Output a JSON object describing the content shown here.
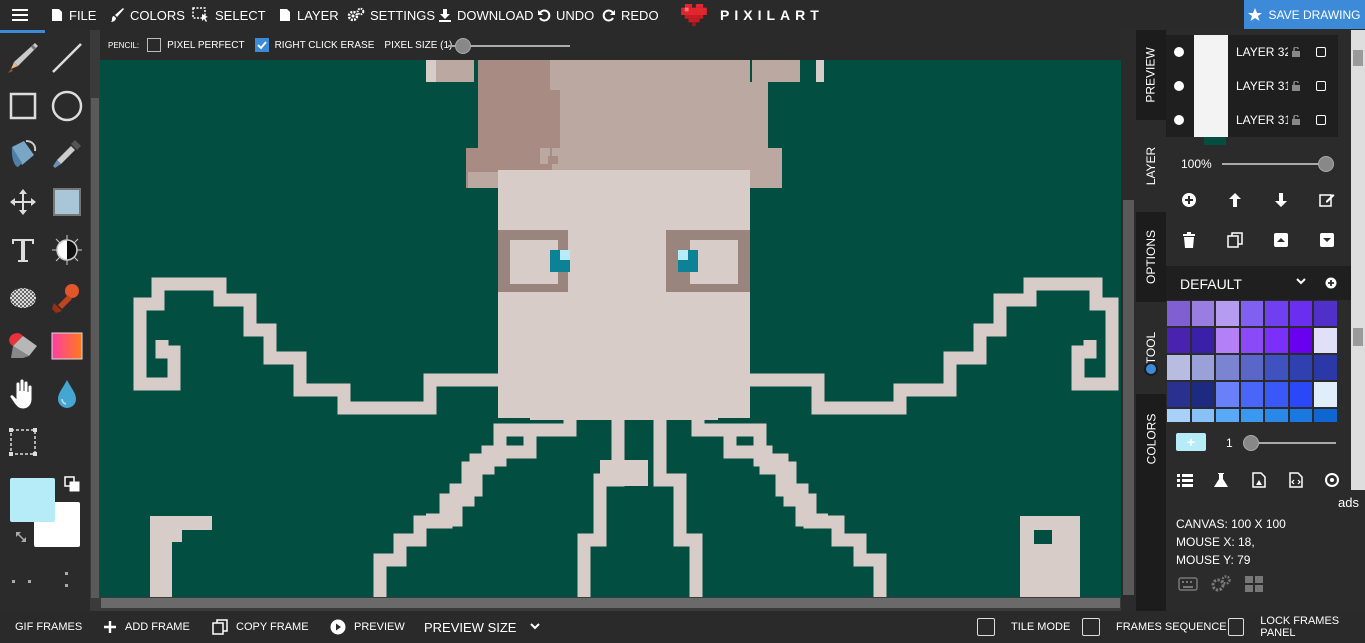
{
  "menu": {
    "file": "FILE",
    "colors": "COLORS",
    "select": "SELECT",
    "layer": "LAYER",
    "settings": "SETTINGS",
    "download": "DOWNLOAD",
    "undo": "UNDO",
    "redo": "REDO",
    "logo_text": "PIXILART",
    "save": "SAVE DRAWING"
  },
  "pencil_options": {
    "tool_label": "PENCIL:",
    "pixel_perfect": "PIXEL PERFECT",
    "pixel_perfect_checked": false,
    "right_click_erase": "RIGHT CLICK ERASE",
    "right_click_erase_checked": true,
    "pixel_size": "PIXEL SIZE (1)"
  },
  "side_tabs": [
    "PREVIEW",
    "LAYER",
    "OPTIONS",
    "TOOL",
    "COLORS"
  ],
  "layers": [
    {
      "name": "LAYER 32"
    },
    {
      "name": "LAYER 31"
    },
    {
      "name": "LAYER 31"
    }
  ],
  "opacity": "100%",
  "palette": {
    "name": "DEFAULT",
    "colors": [
      "#7f5fd2",
      "#9a7de0",
      "#b69cf0",
      "#8060f0",
      "#7040f0",
      "#6a2ef0",
      "#5030c8",
      "#4a22b0",
      "#3a20a8",
      "#b480f8",
      "#8a4af8",
      "#7a30f8",
      "#6a00f0",
      "#e0e0f8",
      "#b8bce0",
      "#9aa0d8",
      "#7a84d0",
      "#5a66c8",
      "#4052c0",
      "#3040b0",
      "#2a38a8",
      "#2a3090",
      "#1c2a80",
      "#6a80f8",
      "#4a66f8",
      "#3a58f8",
      "#2a48f8",
      "#e0eefc",
      "#a8d0f8",
      "#88c0f8",
      "#5aa8f8",
      "#3a98f0",
      "#2a88e8",
      "#1a78e0",
      "#1066d0"
    ]
  },
  "brush_size": "1",
  "canvas_info": {
    "canvas": "CANVAS: 100 X 100",
    "mouse_x": "MOUSE X: 18,",
    "mouse_y": "MOUSE Y: 79"
  },
  "ads": "ads",
  "bottom": {
    "gif_frames": "GIF FRAMES",
    "add_frame": "ADD FRAME",
    "copy_frame": "COPY FRAME",
    "preview": "PREVIEW",
    "preview_size": "PREVIEW SIZE",
    "tile_mode": "TILE MODE",
    "frames_sequence": "FRAMES SEQUENCE",
    "lock_frames_panel": "LOCK FRAMES PANEL"
  },
  "colors": {
    "accent": "#3d8bd8",
    "canvas_bg": "#024e40",
    "primary": "#b5ecf7",
    "secondary": "#ffffff",
    "body": "#d8ccc8",
    "hat_light": "#bba8a0",
    "hat_dark": "#a88c84",
    "eye_frame": "#9a847e",
    "eye": "#0c8296",
    "eye_highlight": "#b5ecf7"
  },
  "icons": {
    "menu": "hamburger-icon",
    "colors": "paint-brush-icon",
    "select": "select-icon",
    "layer": "file-icon",
    "settings": "gears-icon",
    "download": "download-icon",
    "undo": "undo-icon",
    "redo": "redo-icon",
    "save": "star-icon"
  }
}
